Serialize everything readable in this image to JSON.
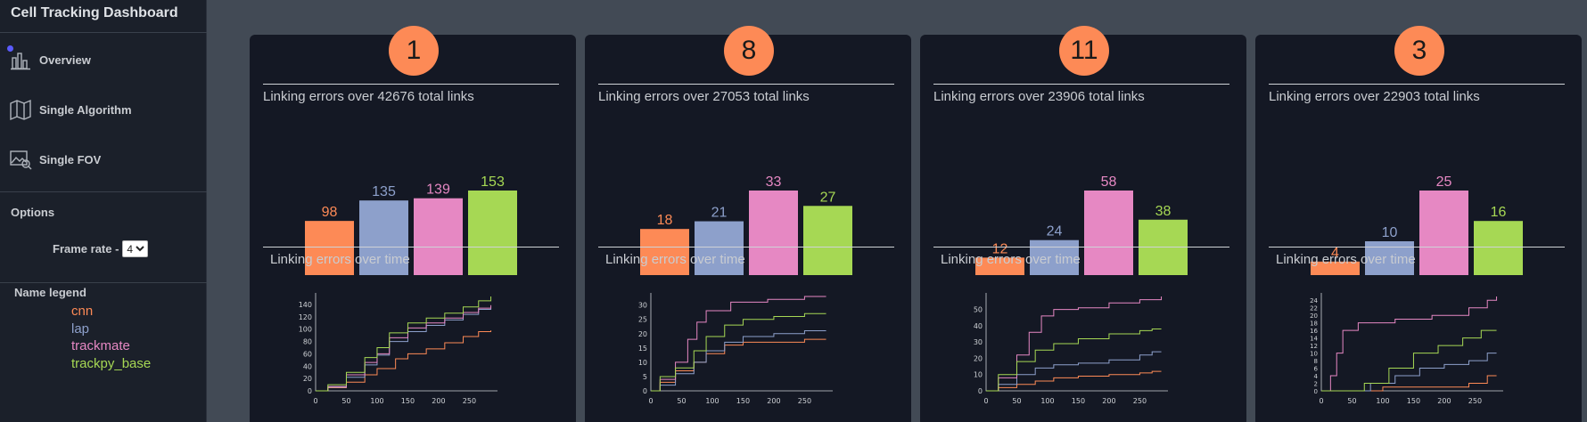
{
  "app": {
    "title": "Cell Tracking Dashboard"
  },
  "sidebar": {
    "nav": [
      {
        "label": "Overview",
        "icon": "bar-chart-icon",
        "active": true
      },
      {
        "label": "Single Algorithm",
        "icon": "map-icon"
      },
      {
        "label": "Single FOV",
        "icon": "image-search-icon"
      }
    ],
    "options_title": "Options",
    "frame_rate_label": "Frame rate -",
    "frame_rate_value": "4",
    "legend_title": "Name legend"
  },
  "colors": {
    "cnn": "#fd8a56",
    "lap": "#8da0cb",
    "trackmate": "#e688c3",
    "trackpy_base": "#a6d854",
    "panel_bg": "#141824",
    "page_bg": "#424a55",
    "badge": "#fd8a56"
  },
  "legend": [
    {
      "name": "cnn",
      "color": "#fd8a56"
    },
    {
      "name": "lap",
      "color": "#8da0cb"
    },
    {
      "name": "trackmate",
      "color": "#e688c3"
    },
    {
      "name": "trackpy_base",
      "color": "#a6d854"
    }
  ],
  "chart_data": [
    {
      "fov": "1",
      "subtitle": "Linking errors over 42676 total links",
      "type": "bar",
      "categories": [
        "cnn",
        "lap",
        "trackmate",
        "trackpy_base"
      ],
      "values": [
        98,
        135,
        139,
        153
      ],
      "line_title": "Linking errors over time",
      "line": {
        "type": "line",
        "x_ticks": [
          0,
          50,
          100,
          150,
          200,
          250
        ],
        "y_ticks": [
          0,
          20,
          40,
          60,
          80,
          100,
          120,
          140
        ],
        "xlim": [
          0,
          290
        ],
        "ylim": [
          0,
          153
        ],
        "series": [
          {
            "name": "cnn",
            "points": [
              [
                0,
                0
              ],
              [
                20,
                5
              ],
              [
                50,
                14
              ],
              [
                80,
                26
              ],
              [
                100,
                36
              ],
              [
                130,
                52
              ],
              [
                150,
                60
              ],
              [
                180,
                68
              ],
              [
                210,
                78
              ],
              [
                240,
                88
              ],
              [
                265,
                96
              ],
              [
                285,
                98
              ]
            ]
          },
          {
            "name": "lap",
            "points": [
              [
                0,
                0
              ],
              [
                20,
                6
              ],
              [
                50,
                22
              ],
              [
                80,
                42
              ],
              [
                100,
                58
              ],
              [
                120,
                80
              ],
              [
                150,
                96
              ],
              [
                180,
                106
              ],
              [
                210,
                115
              ],
              [
                240,
                124
              ],
              [
                265,
                132
              ],
              [
                285,
                135
              ]
            ]
          },
          {
            "name": "trackmate",
            "points": [
              [
                0,
                0
              ],
              [
                20,
                7
              ],
              [
                50,
                26
              ],
              [
                80,
                46
              ],
              [
                100,
                60
              ],
              [
                120,
                86
              ],
              [
                150,
                102
              ],
              [
                180,
                110
              ],
              [
                210,
                118
              ],
              [
                240,
                127
              ],
              [
                265,
                134
              ],
              [
                285,
                139
              ]
            ]
          },
          {
            "name": "trackpy_base",
            "points": [
              [
                0,
                0
              ],
              [
                20,
                10
              ],
              [
                50,
                30
              ],
              [
                80,
                54
              ],
              [
                100,
                70
              ],
              [
                120,
                94
              ],
              [
                150,
                110
              ],
              [
                180,
                118
              ],
              [
                210,
                126
              ],
              [
                240,
                136
              ],
              [
                265,
                146
              ],
              [
                285,
                153
              ]
            ]
          }
        ]
      }
    },
    {
      "fov": "8",
      "subtitle": "Linking errors over 27053 total links",
      "type": "bar",
      "categories": [
        "cnn",
        "lap",
        "trackmate",
        "trackpy_base"
      ],
      "values": [
        18,
        21,
        33,
        27
      ],
      "line_title": "Linking errors over time",
      "line": {
        "type": "line",
        "x_ticks": [
          0,
          50,
          100,
          150,
          200,
          250
        ],
        "y_ticks": [
          0,
          5,
          10,
          15,
          20,
          25,
          30
        ],
        "xlim": [
          0,
          290
        ],
        "ylim": [
          0,
          33
        ],
        "series": [
          {
            "name": "cnn",
            "points": [
              [
                0,
                0
              ],
              [
                15,
                3
              ],
              [
                40,
                7
              ],
              [
                70,
                10
              ],
              [
                90,
                13
              ],
              [
                120,
                16
              ],
              [
                150,
                17
              ],
              [
                200,
                17
              ],
              [
                250,
                18
              ],
              [
                285,
                18
              ]
            ]
          },
          {
            "name": "lap",
            "points": [
              [
                0,
                0
              ],
              [
                15,
                2
              ],
              [
                40,
                6
              ],
              [
                70,
                10
              ],
              [
                90,
                14
              ],
              [
                120,
                17
              ],
              [
                150,
                19
              ],
              [
                200,
                20
              ],
              [
                250,
                21
              ],
              [
                285,
                21
              ]
            ]
          },
          {
            "name": "trackmate",
            "points": [
              [
                0,
                0
              ],
              [
                15,
                4
              ],
              [
                40,
                10
              ],
              [
                60,
                18
              ],
              [
                75,
                24
              ],
              [
                90,
                28
              ],
              [
                130,
                31
              ],
              [
                190,
                32
              ],
              [
                250,
                33
              ],
              [
                285,
                33
              ]
            ]
          },
          {
            "name": "trackpy_base",
            "points": [
              [
                0,
                0
              ],
              [
                15,
                5
              ],
              [
                40,
                8
              ],
              [
                70,
                14
              ],
              [
                90,
                19
              ],
              [
                120,
                23
              ],
              [
                150,
                25
              ],
              [
                200,
                26
              ],
              [
                250,
                27
              ],
              [
                285,
                27
              ]
            ]
          }
        ]
      }
    },
    {
      "fov": "11",
      "subtitle": "Linking errors over 23906 total links",
      "type": "bar",
      "categories": [
        "cnn",
        "lap",
        "trackmate",
        "trackpy_base"
      ],
      "values": [
        12,
        24,
        58,
        38
      ],
      "line_title": "Linking errors over time",
      "line": {
        "type": "line",
        "x_ticks": [
          0,
          50,
          100,
          150,
          200,
          250
        ],
        "y_ticks": [
          0,
          10,
          20,
          30,
          40,
          50
        ],
        "xlim": [
          0,
          290
        ],
        "ylim": [
          0,
          58
        ],
        "series": [
          {
            "name": "cnn",
            "points": [
              [
                0,
                0
              ],
              [
                20,
                2
              ],
              [
                50,
                4
              ],
              [
                80,
                6
              ],
              [
                110,
                8
              ],
              [
                150,
                9
              ],
              [
                200,
                10
              ],
              [
                250,
                11
              ],
              [
                270,
                12
              ],
              [
                285,
                12
              ]
            ]
          },
          {
            "name": "lap",
            "points": [
              [
                0,
                0
              ],
              [
                20,
                4
              ],
              [
                50,
                10
              ],
              [
                80,
                14
              ],
              [
                110,
                16
              ],
              [
                150,
                17
              ],
              [
                200,
                19
              ],
              [
                250,
                22
              ],
              [
                270,
                24
              ],
              [
                285,
                24
              ]
            ]
          },
          {
            "name": "trackmate",
            "points": [
              [
                0,
                0
              ],
              [
                20,
                8
              ],
              [
                50,
                22
              ],
              [
                70,
                36
              ],
              [
                90,
                46
              ],
              [
                110,
                50
              ],
              [
                150,
                51
              ],
              [
                200,
                54
              ],
              [
                250,
                56
              ],
              [
                285,
                58
              ]
            ]
          },
          {
            "name": "trackpy_base",
            "points": [
              [
                0,
                0
              ],
              [
                20,
                10
              ],
              [
                50,
                18
              ],
              [
                80,
                25
              ],
              [
                110,
                29
              ],
              [
                150,
                32
              ],
              [
                200,
                35
              ],
              [
                250,
                37
              ],
              [
                270,
                38
              ],
              [
                285,
                38
              ]
            ]
          }
        ]
      }
    },
    {
      "fov": "3",
      "subtitle": "Linking errors over 22903 total links",
      "type": "bar",
      "categories": [
        "cnn",
        "lap",
        "trackmate",
        "trackpy_base"
      ],
      "values": [
        4,
        10,
        25,
        16
      ],
      "line_title": "Linking errors over time",
      "line": {
        "type": "line",
        "x_ticks": [
          0,
          50,
          100,
          150,
          200,
          250
        ],
        "y_ticks": [
          0,
          2,
          4,
          6,
          8,
          10,
          12,
          14,
          16,
          18,
          20,
          22,
          24
        ],
        "xlim": [
          0,
          290
        ],
        "ylim": [
          0,
          25
        ],
        "series": [
          {
            "name": "cnn",
            "points": [
              [
                0,
                0
              ],
              [
                50,
                0
              ],
              [
                100,
                1
              ],
              [
                150,
                1
              ],
              [
                200,
                1
              ],
              [
                240,
                2
              ],
              [
                270,
                4
              ],
              [
                285,
                4
              ]
            ]
          },
          {
            "name": "lap",
            "points": [
              [
                0,
                0
              ],
              [
                40,
                0
              ],
              [
                80,
                2
              ],
              [
                120,
                4
              ],
              [
                160,
                6
              ],
              [
                200,
                7
              ],
              [
                240,
                8
              ],
              [
                270,
                10
              ],
              [
                285,
                10
              ]
            ]
          },
          {
            "name": "trackmate",
            "points": [
              [
                0,
                0
              ],
              [
                15,
                4
              ],
              [
                25,
                10
              ],
              [
                35,
                16
              ],
              [
                60,
                18
              ],
              [
                120,
                19
              ],
              [
                180,
                20
              ],
              [
                240,
                22
              ],
              [
                270,
                24
              ],
              [
                285,
                25
              ]
            ]
          },
          {
            "name": "trackpy_base",
            "points": [
              [
                0,
                0
              ],
              [
                30,
                0
              ],
              [
                70,
                2
              ],
              [
                110,
                6
              ],
              [
                150,
                10
              ],
              [
                190,
                12
              ],
              [
                230,
                14
              ],
              [
                260,
                16
              ],
              [
                285,
                16
              ]
            ]
          }
        ]
      }
    }
  ]
}
